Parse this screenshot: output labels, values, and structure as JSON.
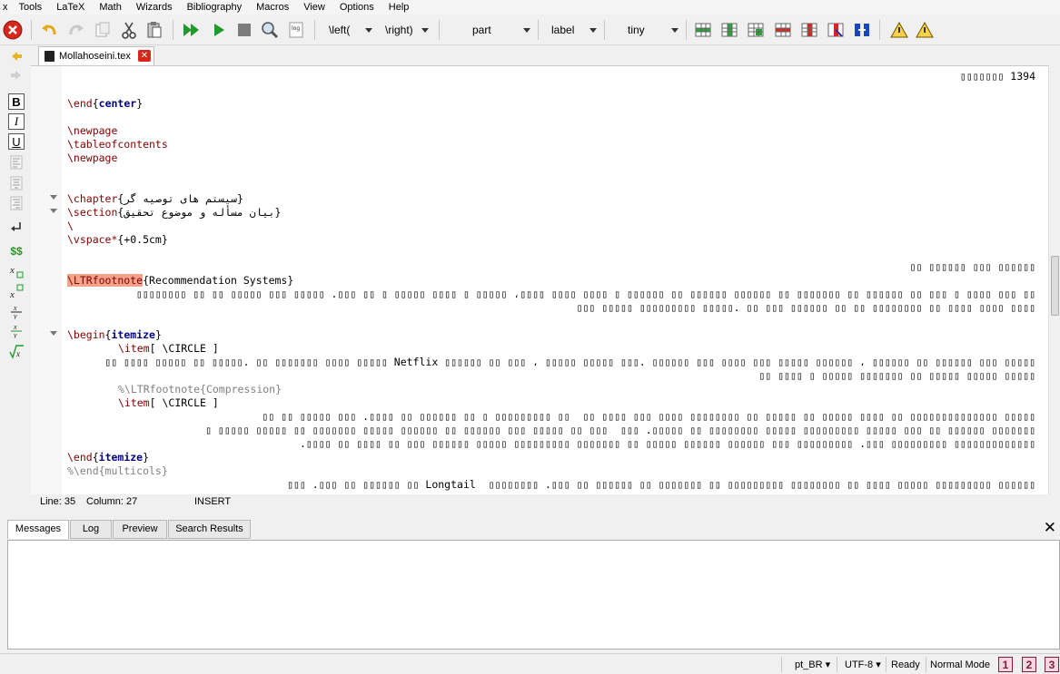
{
  "menu": [
    "x",
    "Tools",
    "LaTeX",
    "Math",
    "Wizards",
    "Bibliography",
    "Macros",
    "View",
    "Options",
    "Help"
  ],
  "toolbar": {
    "left_delim": "\\left(",
    "right_delim": "\\right)",
    "structure_value": "part",
    "ref_value": "label",
    "size_value": "tiny",
    "log_label": "log"
  },
  "leftbar": {
    "bold": "B",
    "italic": "I",
    "underline": "U",
    "money": "$$"
  },
  "tab": {
    "filename": "Mollahoseini.tex"
  },
  "editor": {
    "l0": "1394 ▯▯▯▯▯▯▯",
    "l1_cmd": "\\end",
    "l1_arg": "center",
    "l2": "\\newpage",
    "l3": "\\tableofcontents",
    "l4": "\\newpage",
    "l5_cmd": "\\chapter",
    "l5_arg": "{سیستم های توصیه گر}",
    "l6_cmd": "\\section",
    "l6_arg": "{بیان مسأله و موضوع تحقیق}",
    "l7": "\\",
    "l8_cmd": "\\vspace*",
    "l8_arg": "{+0.5cm}",
    "l9": "▯▯▯▯▯▯ ▯▯▯ ▯▯▯▯▯▯ ▯▯",
    "l10_cmd": "\\LTRfootnote",
    "l10_arg": "{Recommendation Systems}",
    "l11": "▯▯ ▯▯▯ ▯▯▯▯ ▯ ▯▯▯ ▯▯ ▯▯▯▯▯▯ ▯▯ ▯▯▯▯▯▯▯ ▯▯ ▯▯▯▯▯▯ ▯▯▯▯▯▯ ▯▯ ▯▯▯▯▯▯ ▯ ▯▯▯▯ ▯▯▯▯ ▯▯▯▯، ▯▯▯▯▯ ▯ ▯▯▯▯ ▯▯▯▯▯ ▯ ▯▯ ▯▯▯. ▯▯▯▯▯ ▯▯▯ ▯▯▯▯▯ ▯▯ ▯▯ ▯▯▯▯▯▯▯▯",
    "l12": "▯▯▯▯ ▯▯▯▯ ▯▯▯▯ ▯▯ ▯▯▯▯▯▯▯▯ ▯▯ ▯▯ ▯▯▯▯▯▯ ▯▯▯ ▯▯ .▯▯▯▯▯ ▯▯▯▯▯▯▯▯▯ ▯▯▯▯▯ ▯▯▯",
    "l13_cmd": "\\begin",
    "l13_arg": "itemize",
    "l14_cmd": "\\item",
    "l14_arg": "[ \\CIRCLE ]",
    "l15": "▯▯▯▯▯ ▯▯▯ ▯▯▯▯▯▯ ▯▯ ▯▯▯▯▯▯ ، ▯▯▯▯▯▯ ▯▯▯▯▯ ▯▯▯ ▯▯▯▯ ▯▯▯ ▯▯▯▯▯▯ .▯▯▯ ▯▯▯▯▯ ▯▯▯▯▯ ، ▯▯▯ ▯▯ ▯▯▯▯▯▯ Netflix ▯▯▯▯▯ ▯▯▯▯ ▯▯▯▯▯▯▯ ▯▯ .▯▯▯▯▯ ▯▯ ▯▯▯▯▯ ▯▯▯▯ ▯▯",
    "l16": "▯▯▯▯▯ ▯▯▯▯▯ ▯▯▯▯▯ ▯▯ ▯▯▯▯▯▯▯ ▯▯▯▯▯ ▯ ▯▯▯▯ ▯▯",
    "l17_cmd": "%\\LTRfootnote",
    "l17_arg": "{Compression}",
    "l18_cmd": "\\item",
    "l18_arg": "[ \\CIRCLE ]",
    "l19": "▯▯▯▯▯ ▯▯▯▯▯▯▯▯▯▯▯▯▯▯ ▯▯ ▯▯▯▯ ▯▯▯▯▯ ▯▯ ▯▯▯▯▯ ▯▯ ▯▯▯▯▯▯▯▯ ▯▯▯▯ ▯▯▯ ▯▯▯▯ ▯▯  ▯▯ ▯▯▯▯▯▯▯▯▯ ▯ ▯▯ ▯▯▯▯▯▯ ▯▯ ▯▯▯▯. ▯▯▯ ▯▯▯▯▯ ▯▯ ▯▯",
    "l20": "▯▯▯▯▯▯▯ ▯▯▯▯▯▯ ▯▯ ▯▯▯ ▯▯▯▯▯ ▯▯▯▯▯▯▯▯▯ ▯▯▯▯▯ ▯▯▯▯▯▯▯▯ ▯▯ ▯▯▯▯▯. ▯▯▯  ▯▯▯ ▯▯ ▯▯▯▯▯ ▯▯▯ ▯▯▯▯▯▯ ▯▯ ▯▯▯▯▯▯ ▯▯▯▯▯ ▯▯▯▯▯▯▯ ▯▯ ▯▯▯▯▯ ▯▯▯▯▯ ▯",
    "l21": "▯▯▯▯▯▯▯▯▯▯▯▯▯ ▯▯▯▯▯▯▯▯▯ ▯▯▯. ▯▯▯▯▯▯▯▯▯ ▯▯▯ ▯▯▯▯▯▯ ▯▯▯▯▯▯ ▯▯▯▯▯ ▯▯ ▯▯▯▯▯▯▯ ▯▯▯▯▯▯▯▯▯ ▯▯▯▯▯ ▯▯▯▯▯▯ ▯▯▯ ▯▯ ▯▯▯▯ ▯▯ ▯▯▯▯.",
    "l22_cmd": "\\end",
    "l22_arg": "itemize",
    "l23": "%\\end{multicols}",
    "l24": "▯▯▯▯▯▯ ▯▯▯▯▯▯▯▯▯ ▯▯▯▯▯ ▯▯▯▯ ▯▯ ▯▯▯▯▯▯▯▯ ▯▯▯▯▯▯▯▯▯ ▯▯ ▯▯▯▯▯▯▯ ▯▯ ▯▯▯▯▯▯ ▯▯ ▯▯▯. ▯▯▯▯▯▯▯▯  Longtail ▯▯ ▯▯▯▯▯▯ ▯▯ ▯▯▯. ▯▯▯"
  },
  "status_line": {
    "line": "Line: 35",
    "column": "Column: 27",
    "mode": "INSERT"
  },
  "panel_tabs": [
    "Messages",
    "Log",
    "Preview",
    "Search Results"
  ],
  "panel_close": "✕",
  "statusbar": {
    "language": "pt_BR",
    "encoding": "UTF-8",
    "ready": "Ready",
    "mode": "Normal Mode",
    "sq1": "1",
    "sq2": "2",
    "sq3": "3"
  },
  "colors": {
    "accent_red": "#d7271d",
    "run_green": "#1f9a2a",
    "keyword": "#800000",
    "env_keyword": "#000080",
    "highlight": "#f4a38a"
  },
  "icons": [
    "close-red-icon",
    "undo-icon",
    "redo-icon",
    "copy-icon",
    "cut-icon",
    "paste-icon",
    "build-run-icon",
    "run-icon",
    "stop-icon",
    "view-icon",
    "log-icon",
    "table-icons",
    "warning-icons",
    "bookmark-up-icon",
    "bookmark-down-icon",
    "bold-icon",
    "italic-icon",
    "underline-icon",
    "left-align-icon",
    "center-icon",
    "right-align-icon",
    "justify-icon",
    "newline-icon",
    "math-dollar-icon",
    "subscript-icon",
    "superscript-icon",
    "fraction-icon",
    "sqrt-icon",
    "file-icon"
  ]
}
